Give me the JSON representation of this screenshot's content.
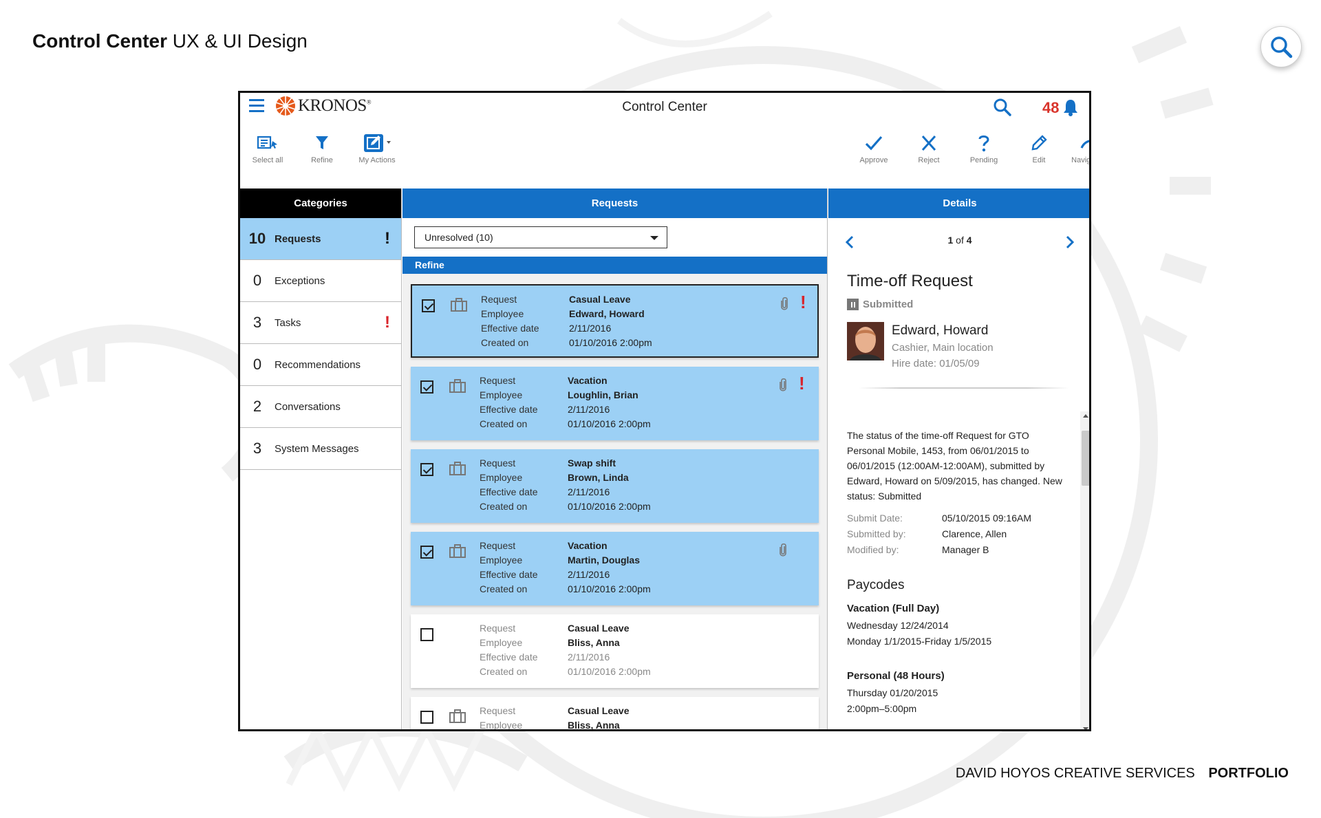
{
  "portfolio": {
    "title_bold": "Control Center",
    "title_rest": "UX & UI Design",
    "footer_left": "DAVID HOYOS CREATIVE SERVICES",
    "footer_right": "PORTFOLIO"
  },
  "header": {
    "logo_text": "KRONOS",
    "logo_registered": "®",
    "title": "Control Center",
    "notification_count": "48"
  },
  "toolbar": {
    "left": [
      {
        "label": "Select all",
        "icon": "select-all-icon"
      },
      {
        "label": "Refine",
        "icon": "filter-icon"
      },
      {
        "label": "My Actions",
        "icon": "my-actions-icon"
      }
    ],
    "right": [
      {
        "label": "Approve",
        "icon": "check-icon"
      },
      {
        "label": "Reject",
        "icon": "x-icon"
      },
      {
        "label": "Pending",
        "icon": "question-icon"
      },
      {
        "label": "Edit",
        "icon": "pencil-icon"
      },
      {
        "label": "Navigate to",
        "icon": "navigate-arrow-icon"
      }
    ]
  },
  "categories": {
    "heading": "Categories",
    "items": [
      {
        "count": "10",
        "label": "Requests",
        "alert": "!",
        "active": true
      },
      {
        "count": "0",
        "label": "Exceptions",
        "alert": ""
      },
      {
        "count": "3",
        "label": "Tasks",
        "alert": "!"
      },
      {
        "count": "0",
        "label": "Recommendations",
        "alert": ""
      },
      {
        "count": "2",
        "label": "Conversations",
        "alert": ""
      },
      {
        "count": "3",
        "label": "System Messages",
        "alert": ""
      }
    ]
  },
  "requests": {
    "heading": "Requests",
    "filter_value": "Unresolved (10)",
    "refine_label": "Refine",
    "field_labels": [
      "Request",
      "Employee",
      "Effective date",
      "Created on"
    ],
    "items": [
      {
        "checked": true,
        "type": "Casual Leave",
        "employee": "Edward, Howard",
        "effective": "2/11/2016",
        "created": "01/10/2016  2:00pm",
        "attachment": true,
        "alert": "!"
      },
      {
        "checked": true,
        "type": "Vacation",
        "employee": "Loughlin, Brian",
        "effective": "2/11/2016",
        "created": "01/10/2016  2:00pm",
        "attachment": true,
        "alert": "!"
      },
      {
        "checked": true,
        "type": "Swap shift",
        "employee": "Brown, Linda",
        "effective": "2/11/2016",
        "created": "01/10/2016  2:00pm",
        "attachment": false,
        "alert": ""
      },
      {
        "checked": true,
        "type": "Vacation",
        "employee": "Martin, Douglas",
        "effective": "2/11/2016",
        "created": "01/10/2016  2:00pm",
        "attachment": true,
        "alert": ""
      },
      {
        "checked": false,
        "type": "Casual Leave",
        "employee": "Bliss, Anna",
        "effective": "2/11/2016",
        "created": "01/10/2016  2:00pm",
        "attachment": false,
        "alert": ""
      },
      {
        "checked": false,
        "type": "Casual Leave",
        "employee": "Bliss, Anna",
        "effective": "",
        "created": "",
        "attachment": false,
        "alert": ""
      }
    ]
  },
  "details": {
    "heading": "Details",
    "page_current": "1",
    "page_of": "of",
    "page_total": "4",
    "title": "Time-off Request",
    "status": "Submitted",
    "employee_name": "Edward, Howard",
    "employee_role": "Cashier, Main location",
    "hire_date": "Hire date: 01/05/09",
    "status_message": "The status of the time-off Request for GTO Personal Mobile, 1453, from 06/01/2015 to 06/01/2015 (12:00AM-12:00AM), submitted by Edward, Howard on 5/09/2015, has changed. New status: Submitted",
    "submit_date_label": "Submit Date:",
    "submit_date": "05/10/2015 09:16AM",
    "submitted_by_label": "Submitted by:",
    "submitted_by": "Clarence, Allen",
    "modified_by_label": "Modified by:",
    "modified_by": "Manager B",
    "paycodes_title": "Paycodes",
    "paycodes": [
      {
        "name": "Vacation (Full Day)",
        "line1": "Wednesday 12/24/2014",
        "line2": "Monday 1/1/2015-Friday 1/5/2015"
      },
      {
        "name": "Personal (48 Hours)",
        "line1": "Thursday 01/20/2015",
        "line2": "2:00pm–5:00pm"
      }
    ]
  },
  "colors": {
    "brand_blue": "#1470c6",
    "selected_blue": "#9cd0f5",
    "alert_red": "#d9242b",
    "logo_orange": "#e55a1c"
  }
}
